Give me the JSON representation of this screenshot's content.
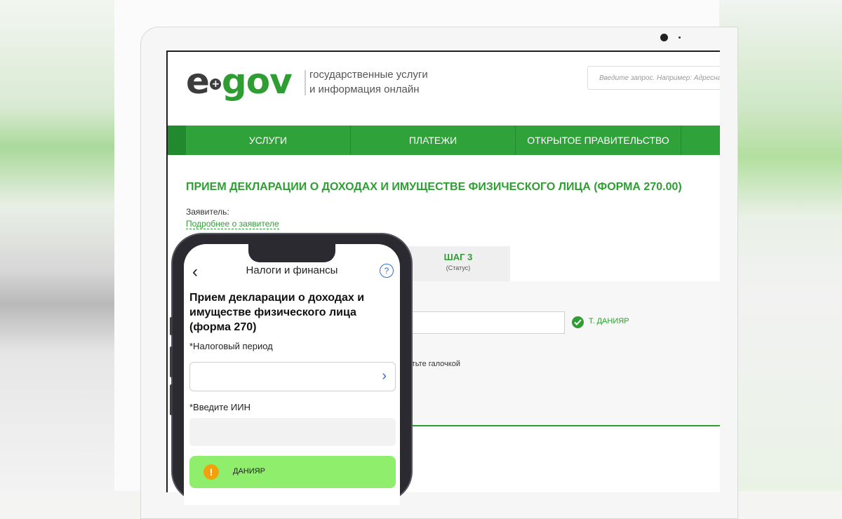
{
  "header": {
    "logo_e": "e",
    "logo_plus": "+",
    "logo_gov": "gov",
    "tagline_line1": "государственные услуги",
    "tagline_line2": "и информация онлайн",
    "search_placeholder": "Введите запрос. Например: Адресна"
  },
  "nav": {
    "items": [
      {
        "label": "УСЛУГИ"
      },
      {
        "label": "ПЛАТЕЖИ"
      },
      {
        "label": "ОТКРЫТОЕ ПРАВИТЕЛЬСТВО"
      }
    ]
  },
  "service": {
    "title": "ПРИЕМ ДЕКЛАРАЦИИ О ДОХОДАХ И ИМУЩЕСТВЕ ФИЗИЧЕСКОГО ЛИЦА (ФОРМА 270.00)",
    "applicant_label": "Заявитель:",
    "applicant_link": "Подробнее о заявителе",
    "step_title": "ШАГ 3",
    "step_subtitle": "(Статус)",
    "verified_name": "Т. ДАНИЯР",
    "check_hint": "етьте галочкой"
  },
  "phone": {
    "back_glyph": "‹",
    "title": "Налоги и финансы",
    "help_glyph": "?",
    "heading": "Прием декларации о доходах и имуществе физического лица (форма 270)",
    "period_label": "*Налоговый период",
    "chevron_glyph": "›",
    "iin_label": "*Введите ИИН",
    "warn_glyph": "!",
    "name_card": "ДАНИЯР"
  },
  "colors": {
    "brand_green": "#2e9e33",
    "nav_green": "#2fa23a",
    "highlight_green": "#8fef6c",
    "warning_orange": "#f2a10a",
    "link_blue": "#2f6fd6"
  }
}
